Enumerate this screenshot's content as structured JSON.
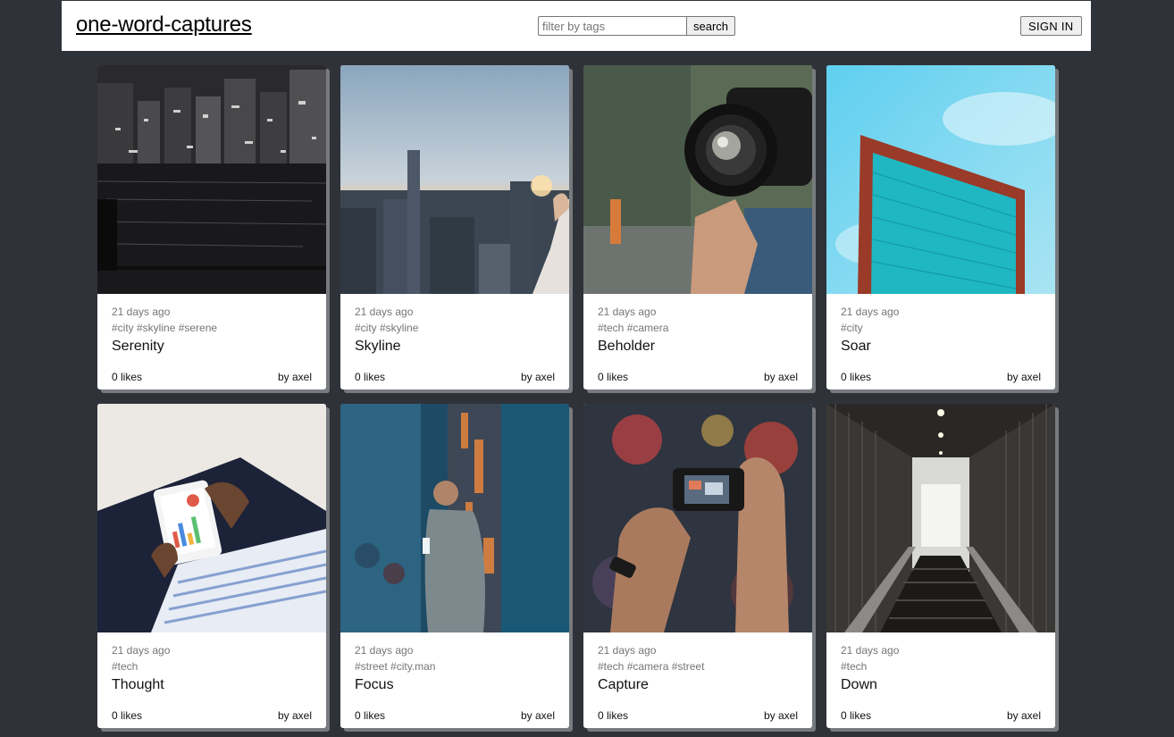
{
  "header": {
    "brand": "one-word-captures",
    "search_placeholder": "filter by tags",
    "search_label": "search",
    "signin_label": "SIGN IN"
  },
  "posts": [
    {
      "time": "21 days ago",
      "tags": "#city #skyline #serene",
      "title": "Serenity",
      "likes": "0 likes",
      "author": "by axel"
    },
    {
      "time": "21 days ago",
      "tags": "#city #skyline",
      "title": "Skyline",
      "likes": "0 likes",
      "author": "by axel"
    },
    {
      "time": "21 days ago",
      "tags": "#tech #camera",
      "title": "Beholder",
      "likes": "0 likes",
      "author": "by axel"
    },
    {
      "time": "21 days ago",
      "tags": "#city",
      "title": "Soar",
      "likes": "0 likes",
      "author": "by axel"
    },
    {
      "time": "21 days ago",
      "tags": "#tech",
      "title": "Thought",
      "likes": "0 likes",
      "author": "by axel"
    },
    {
      "time": "21 days ago",
      "tags": "#street #city.man",
      "title": "Focus",
      "likes": "0 likes",
      "author": "by axel"
    },
    {
      "time": "21 days ago",
      "tags": "#tech #camera #street",
      "title": "Capture",
      "likes": "0 likes",
      "author": "by axel"
    },
    {
      "time": "21 days ago",
      "tags": "#tech",
      "title": "Down",
      "likes": "0 likes",
      "author": "by axel"
    }
  ],
  "colors": {
    "page_background": "#2f3238",
    "card_background": "#ffffff",
    "muted_text": "#757575"
  }
}
